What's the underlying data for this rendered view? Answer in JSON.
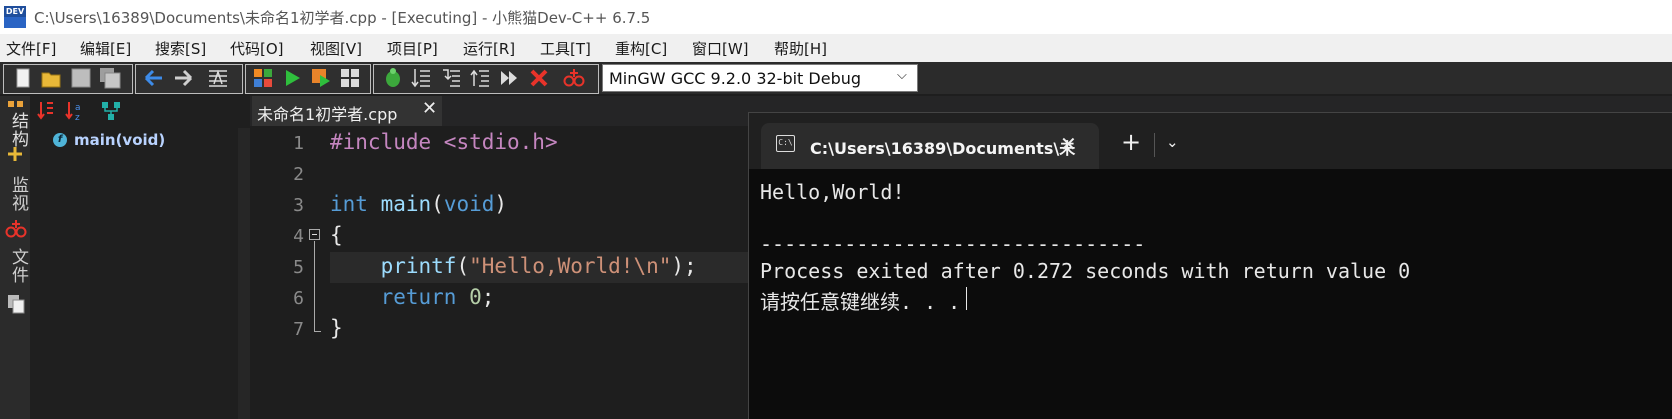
{
  "window": {
    "title": "C:\\Users\\16389\\Documents\\未命名1初学者.cpp - [Executing] - 小熊猫Dev-C++ 6.7.5",
    "app_icon_text": "DEV"
  },
  "menu": [
    "文件[F]",
    "编辑[E]",
    "搜索[S]",
    "代码[O]",
    "视图[V]",
    "项目[P]",
    "运行[R]",
    "工具[T]",
    "重构[C]",
    "窗口[W]",
    "帮助[H]"
  ],
  "toolbar": {
    "compiler": "MinGW GCC 9.2.0 32-bit Debug",
    "icons": [
      "new-file-icon",
      "open-file-icon",
      "save-icon",
      "save-all-icon",
      "back-icon",
      "forward-icon",
      "format-icon",
      "compile-icon",
      "run-icon",
      "compile-run-icon",
      "rebuild-icon",
      "debug-icon",
      "step-over-icon",
      "step-into-icon",
      "step-out-icon",
      "continue-icon",
      "stop-icon",
      "add-watch-icon"
    ]
  },
  "left_strip": {
    "structure_label": "结构",
    "watch_label": "监视",
    "files_label": "文件"
  },
  "class_browser": {
    "items": [
      {
        "icon": "function-icon",
        "icon_glyph": "f",
        "label": "main(void)"
      }
    ]
  },
  "editor": {
    "tab_label": "未命名1初学者.cpp",
    "tab_close": "✕",
    "line_numbers": [
      "1",
      "2",
      "3",
      "4",
      "5",
      "6",
      "7"
    ],
    "lines": [
      "#include <stdio.h>",
      "",
      "int main(void)",
      "{",
      "    printf(\"Hello,World!\\n\");",
      "    return 0;",
      "}"
    ]
  },
  "terminal": {
    "tab_icon_text": "C:\\",
    "tab_title": "C:\\Users\\16389\\Documents\\未",
    "tab_close": "✕",
    "new_tab": "+",
    "dropdown": "⌄",
    "output": [
      "Hello,World!",
      "",
      "--------------------------------",
      "Process exited after 0.272 seconds with return value 0",
      "请按任意键继续. . ."
    ]
  }
}
